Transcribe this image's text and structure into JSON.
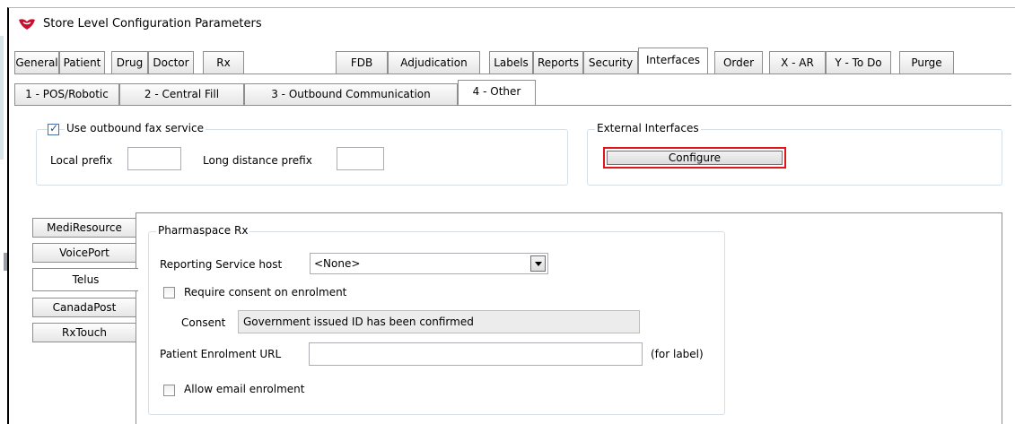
{
  "window": {
    "title": "Store Level Configuration Parameters"
  },
  "main_tabs": [
    {
      "label": "General"
    },
    {
      "label": "Patient"
    },
    {
      "label": "Drug"
    },
    {
      "label": "Doctor"
    },
    {
      "label": "Rx"
    },
    {
      "label": "FDB"
    },
    {
      "label": "Adjudication"
    },
    {
      "label": "Labels"
    },
    {
      "label": "Reports"
    },
    {
      "label": "Security"
    },
    {
      "label": "Interfaces"
    },
    {
      "label": "Order"
    },
    {
      "label": "X - AR"
    },
    {
      "label": "Y - To Do"
    },
    {
      "label": "Purge"
    }
  ],
  "active_main_tab": "Interfaces",
  "sub_tabs": [
    {
      "label": "1 - POS/Robotic"
    },
    {
      "label": "2 - Central Fill"
    },
    {
      "label": "3 - Outbound Communication"
    },
    {
      "label": "4 - Other"
    }
  ],
  "active_sub_tab": "4 - Other",
  "fax": {
    "use_outbound_label": "Use outbound fax service",
    "use_outbound_checked": true,
    "local_prefix_label": "Local prefix",
    "local_prefix_value": "",
    "long_distance_label": "Long distance prefix",
    "long_distance_value": ""
  },
  "external_interfaces": {
    "group_label": "External Interfaces",
    "configure_label": "Configure"
  },
  "side_tabs": [
    {
      "label": "MediResource"
    },
    {
      "label": "VoicePort"
    },
    {
      "label": "Telus"
    },
    {
      "label": "CanadaPost"
    },
    {
      "label": "RxTouch"
    }
  ],
  "active_side_tab": "Telus",
  "pharmaspace": {
    "group_label": "Pharmaspace Rx",
    "reporting_host_label": "Reporting Service host",
    "reporting_host_value": "<None>",
    "require_consent_label": "Require consent on enrolment",
    "require_consent_checked": false,
    "consent_label": "Consent",
    "consent_value": "Government issued ID has been confirmed",
    "enrolment_url_label": "Patient Enrolment URL",
    "enrolment_url_value": "",
    "for_label": "(for label)",
    "allow_email_label": "Allow email enrolment",
    "allow_email_checked": false
  }
}
